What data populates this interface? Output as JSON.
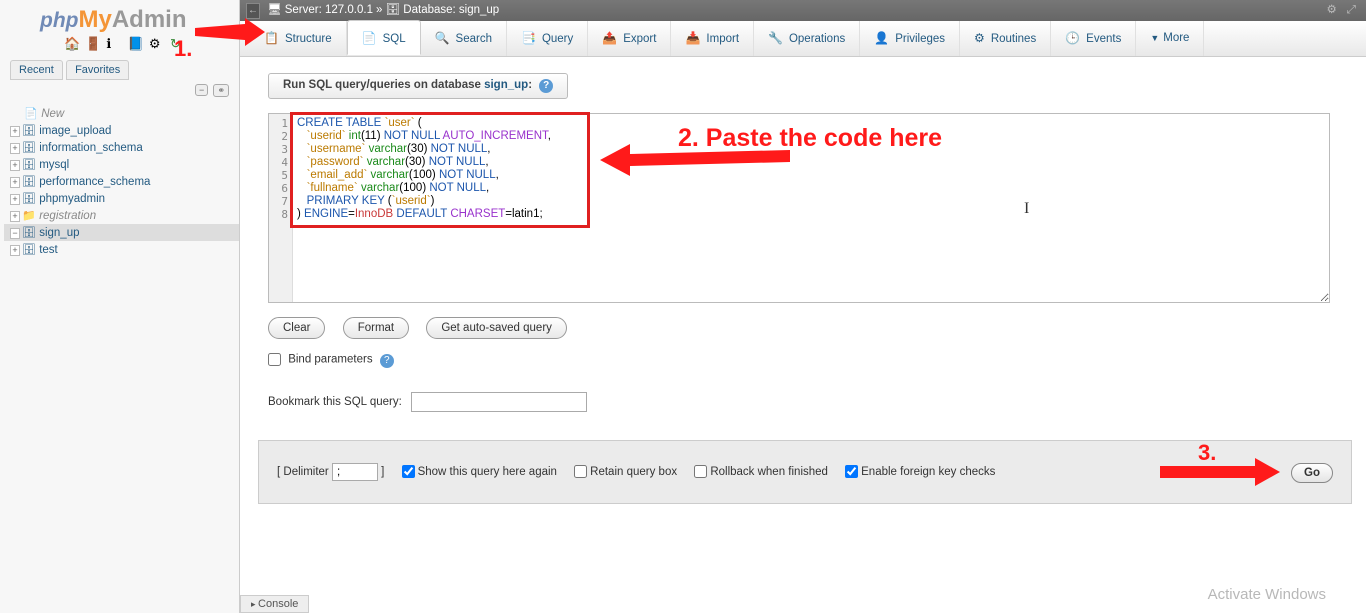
{
  "logo": {
    "p": "php",
    "m": "My",
    "a": "Admin"
  },
  "tabs_rf": {
    "recent": "Recent",
    "fav": "Favorites"
  },
  "tree": [
    {
      "exp": "",
      "ico": "📄",
      "label": "New",
      "special": true
    },
    {
      "exp": "+",
      "ico": "🗄",
      "label": "image_upload"
    },
    {
      "exp": "+",
      "ico": "🗄",
      "label": "information_schema"
    },
    {
      "exp": "+",
      "ico": "🗄",
      "label": "mysql"
    },
    {
      "exp": "+",
      "ico": "🗄",
      "label": "performance_schema"
    },
    {
      "exp": "+",
      "ico": "🗄",
      "label": "phpmyadmin"
    },
    {
      "exp": "+",
      "ico": "📁",
      "label": "registration",
      "special": true
    },
    {
      "exp": "−",
      "ico": "🗄",
      "label": "sign_up",
      "sel": true
    },
    {
      "exp": "+",
      "ico": "🗄",
      "label": "test"
    }
  ],
  "topbar": {
    "server_lbl": "Server: ",
    "server": "127.0.0.1",
    "sep": " » ",
    "db_lbl": "Database: ",
    "db": "sign_up"
  },
  "nav": [
    {
      "icon": "📋",
      "label": "Structure"
    },
    {
      "icon": "📄",
      "label": "SQL",
      "active": true
    },
    {
      "icon": "🔍",
      "label": "Search"
    },
    {
      "icon": "📑",
      "label": "Query"
    },
    {
      "icon": "📤",
      "label": "Export"
    },
    {
      "icon": "📥",
      "label": "Import"
    },
    {
      "icon": "🔧",
      "label": "Operations"
    },
    {
      "icon": "👤",
      "label": "Privileges"
    },
    {
      "icon": "⚙",
      "label": "Routines"
    },
    {
      "icon": "🕒",
      "label": "Events"
    },
    {
      "icon": "▼",
      "label": "More",
      "more": true
    }
  ],
  "sql_hdr": {
    "text": "Run SQL query/queries on database ",
    "db": "sign_up",
    "colon": ":"
  },
  "code_lines": [
    [
      [
        "k-blue",
        "CREATE TABLE"
      ],
      [
        "",
        " "
      ],
      [
        "k-orange",
        "`user`"
      ],
      [
        "",
        " ("
      ]
    ],
    [
      [
        "",
        "   "
      ],
      [
        "k-orange",
        "`userid`"
      ],
      [
        "",
        " "
      ],
      [
        "k-green",
        "int"
      ],
      [
        "",
        "(11) "
      ],
      [
        "k-blue",
        "NOT NULL"
      ],
      [
        "",
        " "
      ],
      [
        "k-purple",
        "AUTO_INCREMENT"
      ],
      [
        "",
        ","
      ]
    ],
    [
      [
        "",
        "   "
      ],
      [
        "k-orange",
        "`username`"
      ],
      [
        "",
        " "
      ],
      [
        "k-green",
        "varchar"
      ],
      [
        "",
        "(30) "
      ],
      [
        "k-blue",
        "NOT NULL"
      ],
      [
        "",
        ","
      ]
    ],
    [
      [
        "",
        "   "
      ],
      [
        "k-orange",
        "`password`"
      ],
      [
        "",
        " "
      ],
      [
        "k-green",
        "varchar"
      ],
      [
        "",
        "(30) "
      ],
      [
        "k-blue",
        "NOT NULL"
      ],
      [
        "",
        ","
      ]
    ],
    [
      [
        "",
        "   "
      ],
      [
        "k-orange",
        "`email_add`"
      ],
      [
        "",
        " "
      ],
      [
        "k-green",
        "varchar"
      ],
      [
        "",
        "(100) "
      ],
      [
        "k-blue",
        "NOT NULL"
      ],
      [
        "",
        ","
      ]
    ],
    [
      [
        "",
        "   "
      ],
      [
        "k-orange",
        "`fullname`"
      ],
      [
        "",
        " "
      ],
      [
        "k-green",
        "varchar"
      ],
      [
        "",
        "(100) "
      ],
      [
        "k-blue",
        "NOT NULL"
      ],
      [
        "",
        ","
      ]
    ],
    [
      [
        "",
        "   "
      ],
      [
        "k-blue",
        "PRIMARY KEY"
      ],
      [
        "",
        " ("
      ],
      [
        "k-orange",
        "`userid`"
      ],
      [
        "",
        ")"
      ]
    ],
    [
      [
        "",
        ") "
      ],
      [
        "k-blue",
        "ENGINE"
      ],
      [
        "",
        "="
      ],
      [
        "k-red",
        "InnoDB"
      ],
      [
        "",
        " "
      ],
      [
        "k-blue",
        "DEFAULT"
      ],
      [
        "",
        " "
      ],
      [
        "k-purple",
        "CHARSET"
      ],
      [
        "",
        "=latin1;"
      ]
    ]
  ],
  "buttons": {
    "clear": "Clear",
    "format": "Format",
    "autosave": "Get auto-saved query"
  },
  "bind": "Bind parameters",
  "bookmark": "Bookmark this SQL query:",
  "footer": {
    "delim_lbl_open": "[ Delimiter",
    "delim_val": ";",
    "delim_lbl_close": " ]",
    "show_again": "Show this query here again",
    "retain": "Retain query box",
    "rollback": "Rollback when finished",
    "fk": "Enable foreign key checks",
    "go": "Go"
  },
  "console": "Console",
  "activate": "Activate Windows",
  "anno": {
    "one": "1.",
    "two": "2. Paste the code here",
    "three": "3."
  }
}
